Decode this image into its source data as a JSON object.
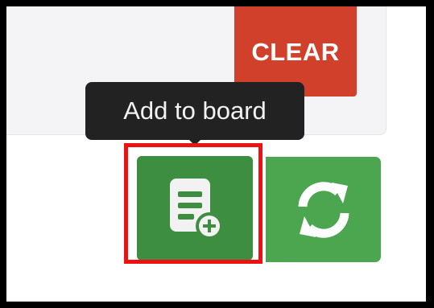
{
  "toolbar": {
    "clear_label": "CLEAR",
    "tooltip_text": "Add to board"
  },
  "icons": {
    "add_to_board": "board-add-icon",
    "refresh": "refresh-icon"
  },
  "colors": {
    "clear_button": "#d1402a",
    "add_button": "#3e8e41",
    "refresh_button": "#4ca64f",
    "tooltip_bg": "#222222",
    "highlight": "#ee1111"
  }
}
